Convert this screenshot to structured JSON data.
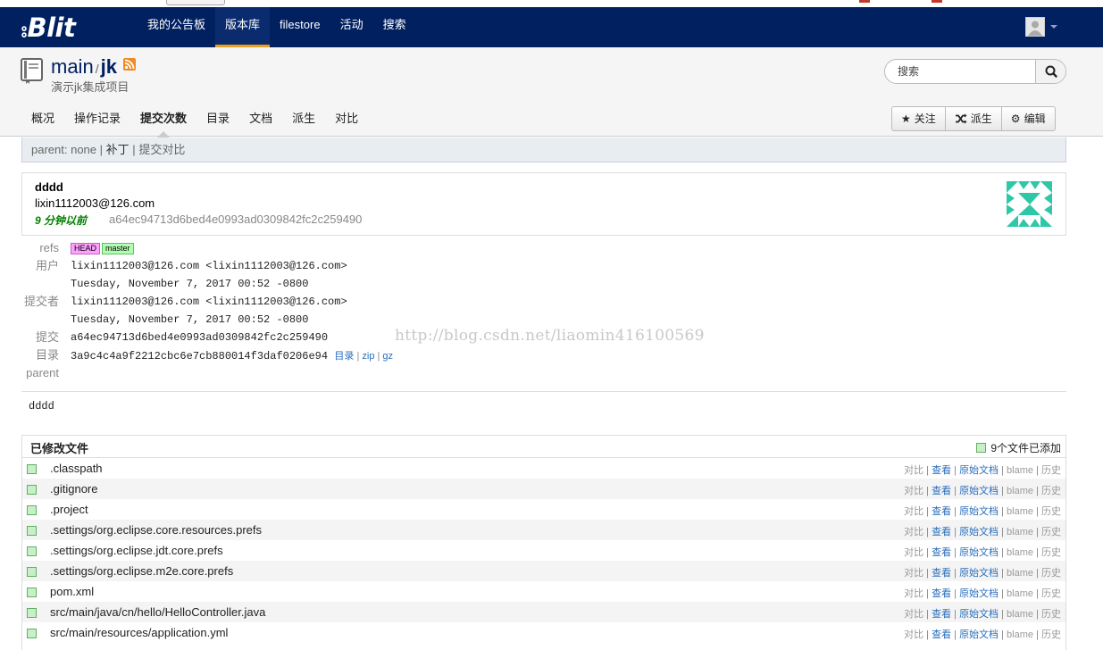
{
  "navbar": {
    "brand": "Blit",
    "items": [
      {
        "label": "我的公告板"
      },
      {
        "label": "版本库",
        "active": true
      },
      {
        "label": "filestore"
      },
      {
        "label": "活动"
      },
      {
        "label": "搜索"
      }
    ]
  },
  "repo": {
    "owner": "main",
    "separator": "/",
    "name": "jk",
    "description": "演示jk集成项目",
    "search_placeholder": "搜索"
  },
  "subnav": {
    "items": [
      "概况",
      "操作记录",
      "提交次数",
      "目录",
      "文档",
      "派生",
      "对比"
    ],
    "active": "提交次数"
  },
  "actions": {
    "watch": "关注",
    "fork": "派生",
    "edit": "编辑"
  },
  "parent_bar": {
    "parent": "parent: none",
    "patch": "补丁",
    "compare": "提交对比",
    "sep": "|"
  },
  "commit": {
    "subject": "dddd",
    "author_email": "lixin1112003@126.com",
    "age": "9 分钟以前",
    "sha": "a64ec94713d6bed4e0993ad0309842fc2c259490",
    "message": "dddd"
  },
  "details": {
    "refs_label": "refs",
    "refs": [
      "HEAD",
      "master"
    ],
    "author_label": "用户",
    "author": "lixin1112003@126.com <lixin1112003@126.com>",
    "author_date": "Tuesday, November 7, 2017 00:52 -0800",
    "committer_label": "提交者",
    "committer": "lixin1112003@126.com <lixin1112003@126.com>",
    "committer_date": "Tuesday, November 7, 2017 00:52 -0800",
    "commit_label": "提交",
    "commit_sha": "a64ec94713d6bed4e0993ad0309842fc2c259490",
    "tree_label": "目录",
    "tree_sha": "3a9c4c4a9f2212cbc6e7cb880014f3daf0206e94",
    "tree_links": [
      "目录",
      "zip",
      "gz"
    ],
    "parent_label": "parent"
  },
  "watermark": "http://blog.csdn.net/liaomin416100569",
  "files": {
    "title": "已修改文件",
    "summary": "9个文件已添加",
    "action_labels": {
      "diff": "对比",
      "view": "查看",
      "raw": "原始文档",
      "blame": "blame",
      "history": "历史"
    },
    "items": [
      ".classpath",
      ".gitignore",
      ".project",
      ".settings/org.eclipse.core.resources.prefs",
      ".settings/org.eclipse.jdt.core.prefs",
      ".settings/org.eclipse.m2e.core.prefs",
      "pom.xml",
      "src/main/java/cn/hello/HelloController.java",
      "src/main/resources/application.yml"
    ]
  }
}
